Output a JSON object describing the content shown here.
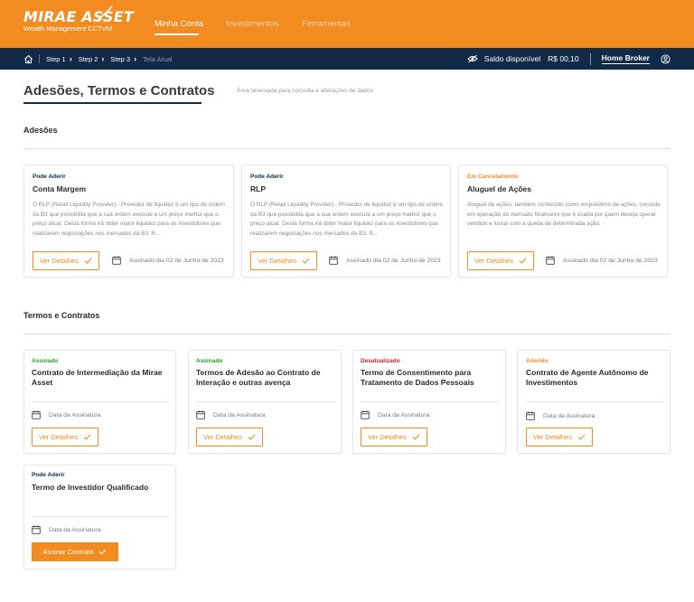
{
  "header": {
    "logo_main": "MIRAE ASSET",
    "logo_sub": "Wealth Management CCTVM",
    "nav": [
      "Minha Conta",
      "Investimentos",
      "Ferramentas"
    ]
  },
  "breadcrumb": {
    "items": [
      "Step 1",
      "Step 2",
      "Step 3"
    ],
    "current": "Tela Atual"
  },
  "account": {
    "saldo_label": "Saldo disponível",
    "saldo_value": "R$ 00,10",
    "home_broker": "Home Broker"
  },
  "page": {
    "title": "Adesões, Termos e Contratos",
    "subtitle": "Área reservada para consulta e alterações de dados"
  },
  "adesoes": {
    "section_title": "Adesões",
    "cards": [
      {
        "status": "Pode Aderir",
        "title": "Conta Margem",
        "desc": "O RLP (Retail Liquidity Provider) - Provedor de liquidez é um tipo de ordem da B3 que possibilita que a sua ordem execute a um preço melhor que o preço atual. Desta forma irá obter maior liquidez para os investidores que realizarem negociações nos mercados da B3. R...",
        "button": "Ver Detalhes",
        "signed": "Assinado dia 02 de Junho de 2023"
      },
      {
        "status": "Pode Aderir",
        "title": "RLP",
        "desc": "O RLP (Retail Liquidity Provider) - Provedor de liquidez é um tipo de ordem da B3 que possibilita que a sua ordem execute a um preço melhor que o preço atual. Desta forma irá obter maior liquidez para os investidores que realizarem negociações nos mercados da B3. R...",
        "button": "Ver Detalhes",
        "signed": "Assinado dia 02 de Junho de 2023"
      },
      {
        "status": "Em Cancelamento",
        "title": "Aluguel de Ações",
        "desc": "Aluguel de ações, também conhecido como empréstimo de ações, consiste em operação do mercado financeiro que é usada por quem deseja operar vendido e lucrar com a queda de determinada ação.",
        "button": "Ver Detalhes",
        "signed": "Assinado dia 02 de Junho de 2023"
      }
    ]
  },
  "termos": {
    "section_title": "Termos e  Contratos",
    "cards": [
      {
        "status": "Assinado",
        "title": "Contrato de Intermediação da Mirae Asset",
        "date": "Data da Assinatura",
        "button": "Ver Detalhes"
      },
      {
        "status": "Assinado",
        "title": "Termos de Adesão ao Contrato de Interação e outras avença",
        "date": "Data da Assinatura",
        "button": "Ver Detalhes"
      },
      {
        "status": "Desatualizado",
        "title": "Termo de Consentimento para Tratamento de Dados Pessoais",
        "date": "Data da Assinatura",
        "button": "Ver Detalhes"
      },
      {
        "status": "Aderido",
        "title": "Contrato de Agente Autônomo de Investimentos",
        "date": "Data da Assinatura",
        "button": "Ver Detalhes"
      },
      {
        "status": "Pode Aderir",
        "title": "Termo de Investidor Qualificado",
        "date": "Data da Assinatura",
        "button": "Assinar Contrato"
      }
    ]
  },
  "colors": {
    "brand_orange": "#f28b20",
    "navy": "#102a47",
    "status_green": "#2a9a2a",
    "status_red": "#d42020"
  }
}
